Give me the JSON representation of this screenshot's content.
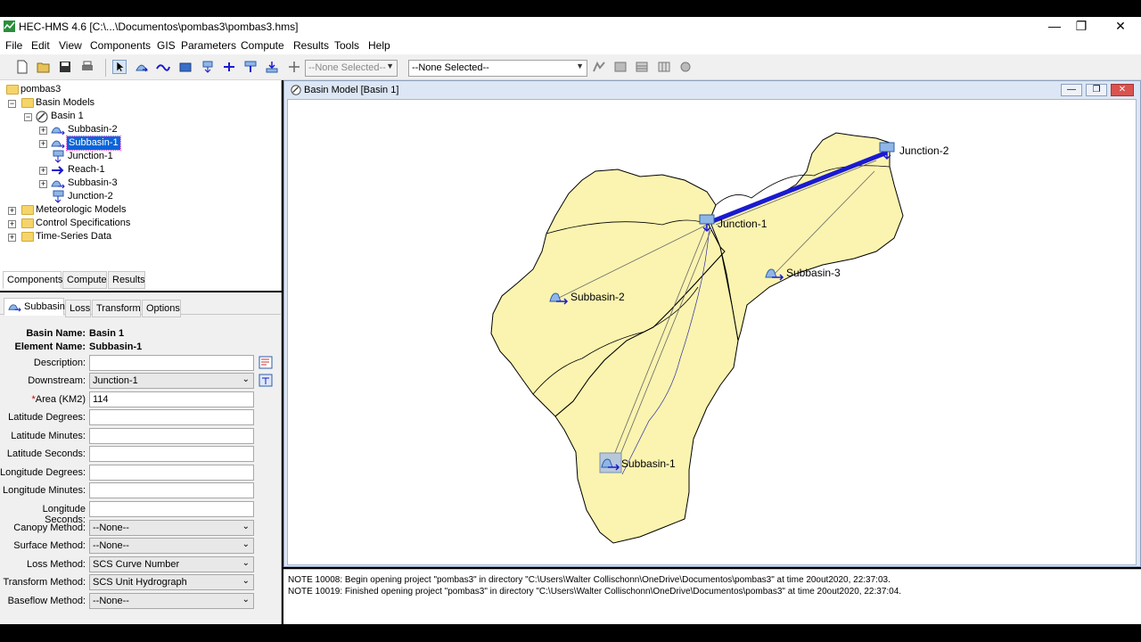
{
  "window": {
    "title": "HEC-HMS 4.6 [C:\\...\\Documentos\\pombas3\\pombas3.hms]",
    "minimize": "—",
    "restore": "❐",
    "close": "✕"
  },
  "menu": [
    "File",
    "Edit",
    "View",
    "Components",
    "GIS",
    "Parameters",
    "Compute",
    "Results",
    "Tools",
    "Help"
  ],
  "toolbar": {
    "combo1": "--None Selected--",
    "combo2": "--None Selected--"
  },
  "tree": {
    "root": "pombas3",
    "basin_models": "Basin Models",
    "basin1": "Basin 1",
    "items": [
      "Subbasin-2",
      "Subbasin-1",
      "Junction-1",
      "Reach-1",
      "Subbasin-3",
      "Junction-2"
    ],
    "meteorologic": "Meteorologic Models",
    "control": "Control Specifications",
    "timeseries": "Time-Series Data"
  },
  "nav_tabs": [
    "Components",
    "Compute",
    "Results"
  ],
  "prop_tabs": [
    "Subbasin",
    "Loss",
    "Transform",
    "Options"
  ],
  "props": {
    "basin_name_label": "Basin Name:",
    "basin_name": "Basin 1",
    "element_name_label": "Element Name:",
    "element_name": "Subbasin-1",
    "description_label": "Description:",
    "description": "",
    "downstream_label": "Downstream:",
    "downstream": "Junction-1",
    "area_star": "*",
    "area_label": "Area (KM2)",
    "area": "114",
    "lat_deg_label": "Latitude Degrees:",
    "lat_min_label": "Latitude Minutes:",
    "lat_sec_label": "Latitude Seconds:",
    "lon_deg_label": "Longitude Degrees:",
    "lon_min_label": "Longitude Minutes:",
    "lon_sec_label": "Longitude Seconds:",
    "canopy_label": "Canopy Method:",
    "canopy": "--None--",
    "surface_label": "Surface Method:",
    "surface": "--None--",
    "loss_label": "Loss Method:",
    "loss": "SCS Curve Number",
    "transform_label": "Transform Method:",
    "transform": "SCS Unit Hydrograph",
    "baseflow_label": "Baseflow Method:",
    "baseflow": "--None--"
  },
  "map": {
    "title": "Basin Model [Basin 1]",
    "labels": {
      "junction2": "Junction-2",
      "junction1": "Junction-1",
      "subbasin2": "Subbasin-2",
      "subbasin3": "Subbasin-3",
      "subbasin1": "Subbasin-1"
    },
    "fill_color": "#fbf4b0",
    "reach_color": "#1a1ad0"
  },
  "console": [
    "NOTE 10008:  Begin opening project \"pombas3\" in directory \"C:\\Users\\Walter Collischonn\\OneDrive\\Documentos\\pombas3\" at time 20out2020, 22:37:03.",
    "NOTE 10019:  Finished opening project \"pombas3\" in directory \"C:\\Users\\Walter Collischonn\\OneDrive\\Documentos\\pombas3\" at time 20out2020, 22:37:04."
  ]
}
